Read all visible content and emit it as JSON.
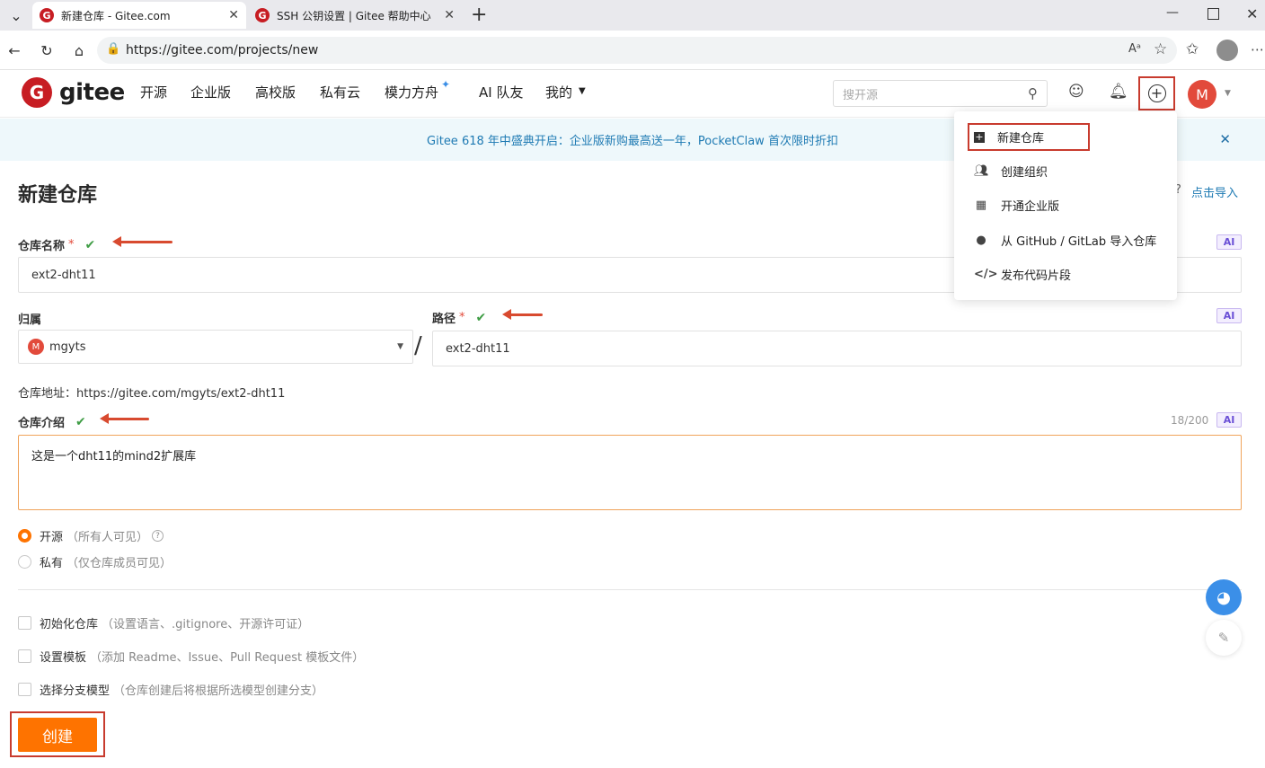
{
  "browser": {
    "tabs": [
      {
        "label": "新建仓库 - Gitee.com",
        "active": true
      },
      {
        "label": "SSH 公钥设置 | Gitee 帮助中心",
        "active": false
      }
    ],
    "url": "https://gitee.com/projects/new",
    "new_tab": "+"
  },
  "header": {
    "logo_text": "gitee",
    "nav": [
      "开源",
      "企业版",
      "高校版",
      "私有云",
      "模力方舟",
      "AI 队友",
      "我的"
    ],
    "search_placeholder": "搜开源",
    "avatar_letter": "M"
  },
  "banner": {
    "text": "Gitee 618 年中盛典开启：企业版新购最高送一年，PocketClaw 首次限时折扣"
  },
  "dropdown": {
    "items": [
      "新建仓库",
      "创建组织",
      "开通企业版",
      "从 GitHub / GitLab 导入仓库",
      "发布代码片段"
    ]
  },
  "form": {
    "title": "新建仓库",
    "import_hint": "?",
    "import_link": "点击导入",
    "repo_name_label": "仓库名称",
    "repo_name_value": "ext2-dht11",
    "owner_label": "归属",
    "owner_value": "mgyts",
    "owner_avatar": "M",
    "separator": "/",
    "path_label": "路径",
    "path_value": "ext2-dht11",
    "repo_address": "仓库地址：https://gitee.com/mgyts/ext2-dht11",
    "intro_label": "仓库介绍",
    "intro_counter": "18/200",
    "intro_value": "这是一个dht11的mind2扩展库",
    "ai_label": "AI",
    "required_mark": "*",
    "visibility": [
      {
        "label": "开源",
        "hint": "（所有人可见）",
        "selected": true
      },
      {
        "label": "私有",
        "hint": "（仅仓库成员可见）",
        "selected": false
      }
    ],
    "options": [
      {
        "label": "初始化仓库",
        "hint": "（设置语言、.gitignore、开源许可证）"
      },
      {
        "label": "设置模板",
        "hint": "（添加 Readme、Issue、Pull Request 模板文件）"
      },
      {
        "label": "选择分支模型",
        "hint": "（仓库创建后将根据所选模型创建分支）"
      }
    ],
    "create_button": "创建"
  }
}
